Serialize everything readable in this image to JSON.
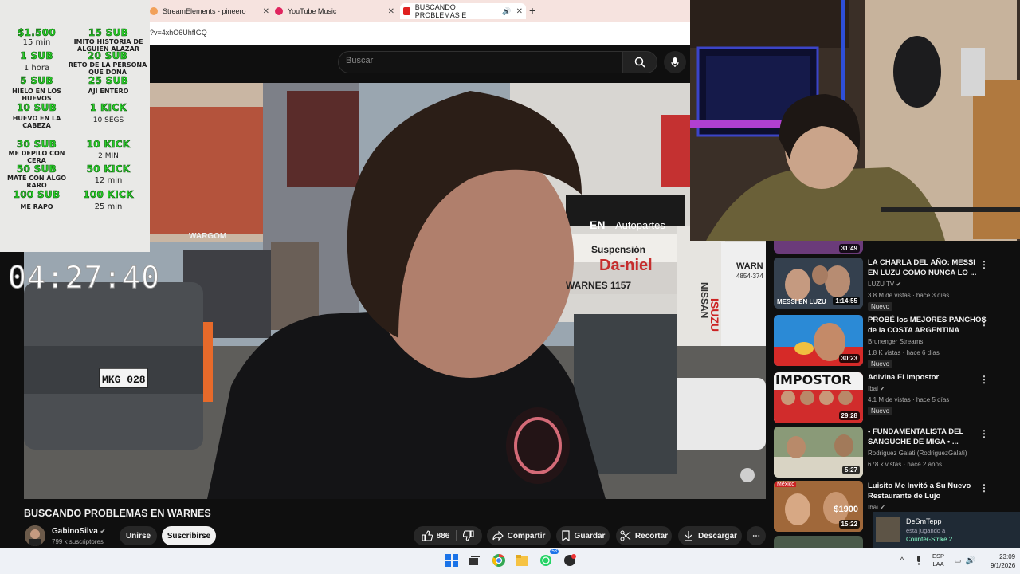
{
  "browser": {
    "tabs": [
      {
        "label": "StreamElements - pineero"
      },
      {
        "label": "YouTube Music"
      },
      {
        "label": "BUSCANDO PROBLEMAS E"
      }
    ],
    "url_fragment": "?v=4xhO6UhfIGQ"
  },
  "youtube": {
    "search_placeholder": "Buscar"
  },
  "overlay": {
    "goals": [
      {
        "amount": "$1.500",
        "desc": "15 min"
      },
      {
        "amount": "15 SUB",
        "desc": "IMITO HISTORIA DE ALGUIEN ALAZAR"
      },
      {
        "amount": "1 SUB",
        "desc": "1 hora"
      },
      {
        "amount": "20 SUB",
        "desc": "RETO DE LA PERSONA QUE DONA"
      },
      {
        "amount": "5 SUB",
        "desc": "HIELO EN LOS HUEVOS"
      },
      {
        "amount": "25 SUB",
        "desc": "AJI ENTERO"
      },
      {
        "amount": "10 SUB",
        "desc": "HUEVO EN LA CABEZA"
      },
      {
        "amount": "1 KICK",
        "desc": "10 SEGS"
      },
      {
        "amount": "30 SUB",
        "desc": "ME DEPILO CON CERA"
      },
      {
        "amount": "10 KICK",
        "desc": "2 MIN"
      },
      {
        "amount": "50 SUB",
        "desc": "MATE CON ALGO RARO"
      },
      {
        "amount": "50 KICK",
        "desc": "12 min"
      },
      {
        "amount": "100 SUB",
        "desc": "ME RAPO"
      },
      {
        "amount": "100 KICK",
        "desc": "25 min"
      }
    ],
    "timer": "04:27:40"
  },
  "video": {
    "title": "BUSCANDO PROBLEMAS EN WARNES",
    "channel": "GabinoSilva",
    "subscribers": "799 k suscriptores",
    "join_label": "Unirse",
    "subscribe_label": "Suscribirse",
    "likes": "886",
    "share_label": "Compartir",
    "save_label": "Guardar",
    "clip_label": "Recortar",
    "download_label": "Descargar",
    "scene_text": {
      "autopartes": "Autopartes",
      "suspension": "Suspensión",
      "daniel": "Da-niel",
      "warnes": "WARNES 1157",
      "plate": "MKG 028",
      "wargom": "WARGOM",
      "isuzu": "ISUZU",
      "nissan": "NISSAN",
      "warn": "WARN",
      "phone": "4854-374",
      "en": "EN"
    }
  },
  "sidebar": {
    "top_partial_duration": "31:49",
    "items": [
      {
        "title": "LA CHARLA DEL AÑO: MESSI EN LUZU COMO NUNCA LO ...",
        "channel": "LUZU TV",
        "verified": true,
        "meta": "3.8 M de vistas · hace 3 días",
        "badge": "Nuevo",
        "duration": "1:14:55",
        "thumb_text": "MESSI EN LUZU",
        "thumb_color": "#3d4a5a"
      },
      {
        "title": "PROBÉ los MEJORES PANCHOS de la COSTA ARGENTINA",
        "channel": "Brunenger Streams",
        "verified": false,
        "meta": "1.8 K vistas · hace 6 días",
        "badge": "Nuevo",
        "duration": "30:23",
        "thumb_text": "",
        "thumb_color": "#c9332b"
      },
      {
        "title": "Adivina El Impostor",
        "channel": "Ibai",
        "verified": true,
        "meta": "4.1 M de vistas · hace 5 días",
        "badge": "Nuevo",
        "duration": "29:28",
        "thumb_text": "IMPOSTOR",
        "thumb_color": "#c72828"
      },
      {
        "title": "• FUNDAMENTALISTA DEL SANGUCHE DE MIGA • ...",
        "channel": "Rodriguez Galati (RodriguezGalati)",
        "verified": false,
        "meta": "678 k vistas · hace 2 años",
        "badge": "",
        "duration": "5:27",
        "thumb_text": "",
        "thumb_color": "#5c7a52"
      },
      {
        "title": "Luisito Me Invitó a Su Nuevo Restaurante de Lujo",
        "channel": "Ibai",
        "verified": true,
        "meta": "",
        "badge": "",
        "duration": "15:22",
        "thumb_text": "$1900",
        "thumb_color": "#b8763a",
        "thumb_tag": "México"
      }
    ]
  },
  "notification": {
    "name": "DeSmTepp",
    "status": "está jugando a",
    "game": "Counter-Strike 2"
  },
  "taskbar": {
    "lang_line1": "ESP",
    "lang_line2": "LAA",
    "time": "23:09",
    "date": "9/1/2026",
    "whatsapp_badge": "53"
  }
}
